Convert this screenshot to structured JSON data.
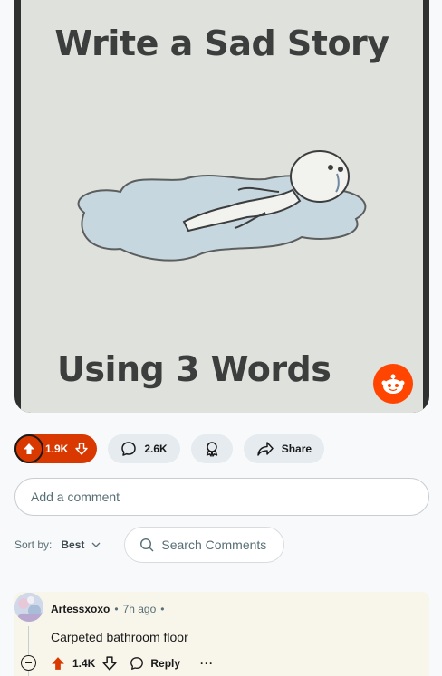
{
  "meme": {
    "title": "Write a Sad Story",
    "subtitle": "Using 3 Words"
  },
  "post_actions": {
    "upvotes": "1.9K",
    "comments": "2.6K",
    "share_label": "Share"
  },
  "add_comment": {
    "placeholder": "Add a comment"
  },
  "sort": {
    "label": "Sort by:",
    "value": "Best",
    "search_placeholder": "Search Comments"
  },
  "comment": {
    "author": "Artessxoxo",
    "separator": "•",
    "time": "7h ago",
    "trailing_separator": "•",
    "text": "Carpeted bathroom floor",
    "votes": "1.4K",
    "reply_label": "Reply",
    "more_label": "···"
  },
  "colors": {
    "upvote_active": "#d93900",
    "reddit_orange": "#ff4500",
    "pill_bg": "#e5ebee",
    "comment_highlight": "#f8f5ea"
  }
}
